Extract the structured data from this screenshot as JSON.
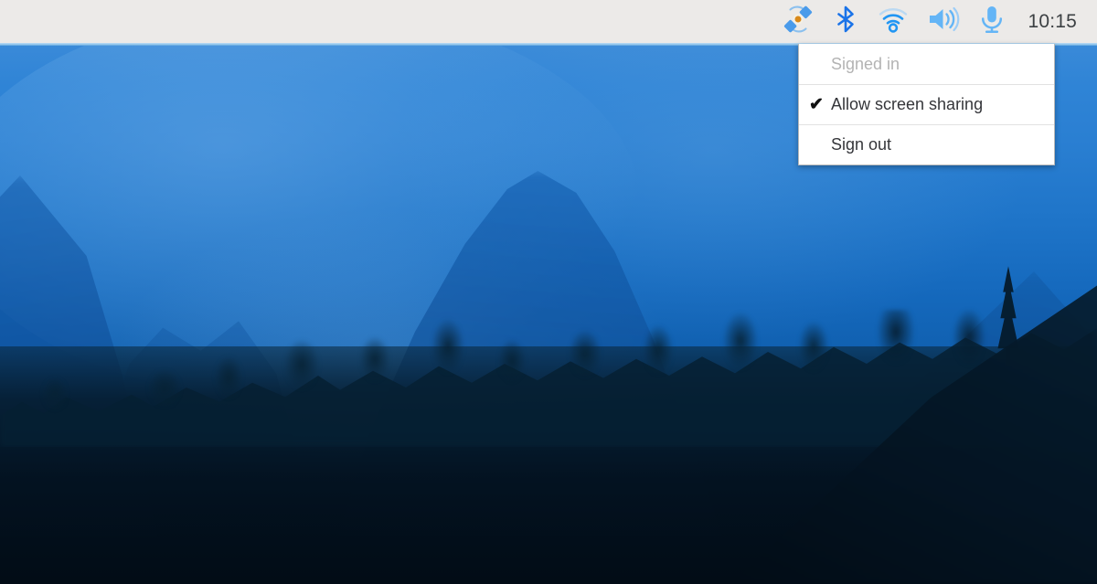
{
  "shelf": {
    "background_color": "#ECEAE8",
    "clock": "10:15",
    "tray_icons": [
      {
        "name": "screen-share-icon",
        "label": "Screen sharing",
        "color": "#4A90E2",
        "accent_color": "#D9891A"
      },
      {
        "name": "bluetooth-icon",
        "label": "Bluetooth",
        "color": "#1A73E8"
      },
      {
        "name": "wifi-icon",
        "label": "Wi-Fi network",
        "color": "#2196F3"
      },
      {
        "name": "volume-icon",
        "label": "Volume",
        "color": "#64B5F6"
      },
      {
        "name": "microphone-icon",
        "label": "Microphone",
        "color": "#64B5F6"
      }
    ]
  },
  "share_menu": {
    "items": [
      {
        "label": "Signed in",
        "checked": false,
        "check_glyph": "",
        "disabled": true
      },
      {
        "label": "Allow screen sharing",
        "checked": true,
        "check_glyph": "✔",
        "disabled": false
      },
      {
        "label": "Sign out",
        "checked": false,
        "check_glyph": "",
        "disabled": false
      }
    ]
  },
  "wallpaper": {
    "description": "Misty blue karst mountain landscape with dark tree silhouettes",
    "sky_color": "#2B7FD4",
    "horizon_color": "#0F5EAD",
    "foreground_color": "#06203A"
  }
}
